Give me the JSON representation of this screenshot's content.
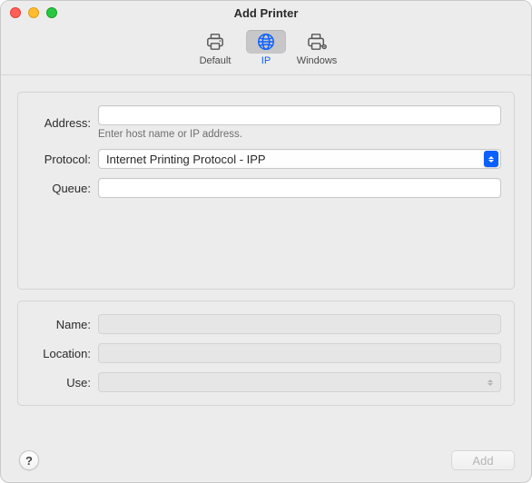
{
  "window": {
    "title": "Add Printer"
  },
  "toolbar": {
    "items": [
      {
        "label": "Default"
      },
      {
        "label": "IP"
      },
      {
        "label": "Windows"
      }
    ],
    "selected_index": 1
  },
  "form_top": {
    "address": {
      "label": "Address:",
      "value": "",
      "hint": "Enter host name or IP address."
    },
    "protocol": {
      "label": "Protocol:",
      "value": "Internet Printing Protocol - IPP"
    },
    "queue": {
      "label": "Queue:",
      "value": ""
    }
  },
  "form_bottom": {
    "name": {
      "label": "Name:",
      "value": ""
    },
    "location": {
      "label": "Location:",
      "value": ""
    },
    "use": {
      "label": "Use:",
      "value": ""
    }
  },
  "footer": {
    "help_label": "?",
    "add_label": "Add",
    "add_enabled": false
  },
  "icons": {
    "default": "printer-icon",
    "ip": "globe-icon",
    "windows": "printer-network-icon"
  }
}
